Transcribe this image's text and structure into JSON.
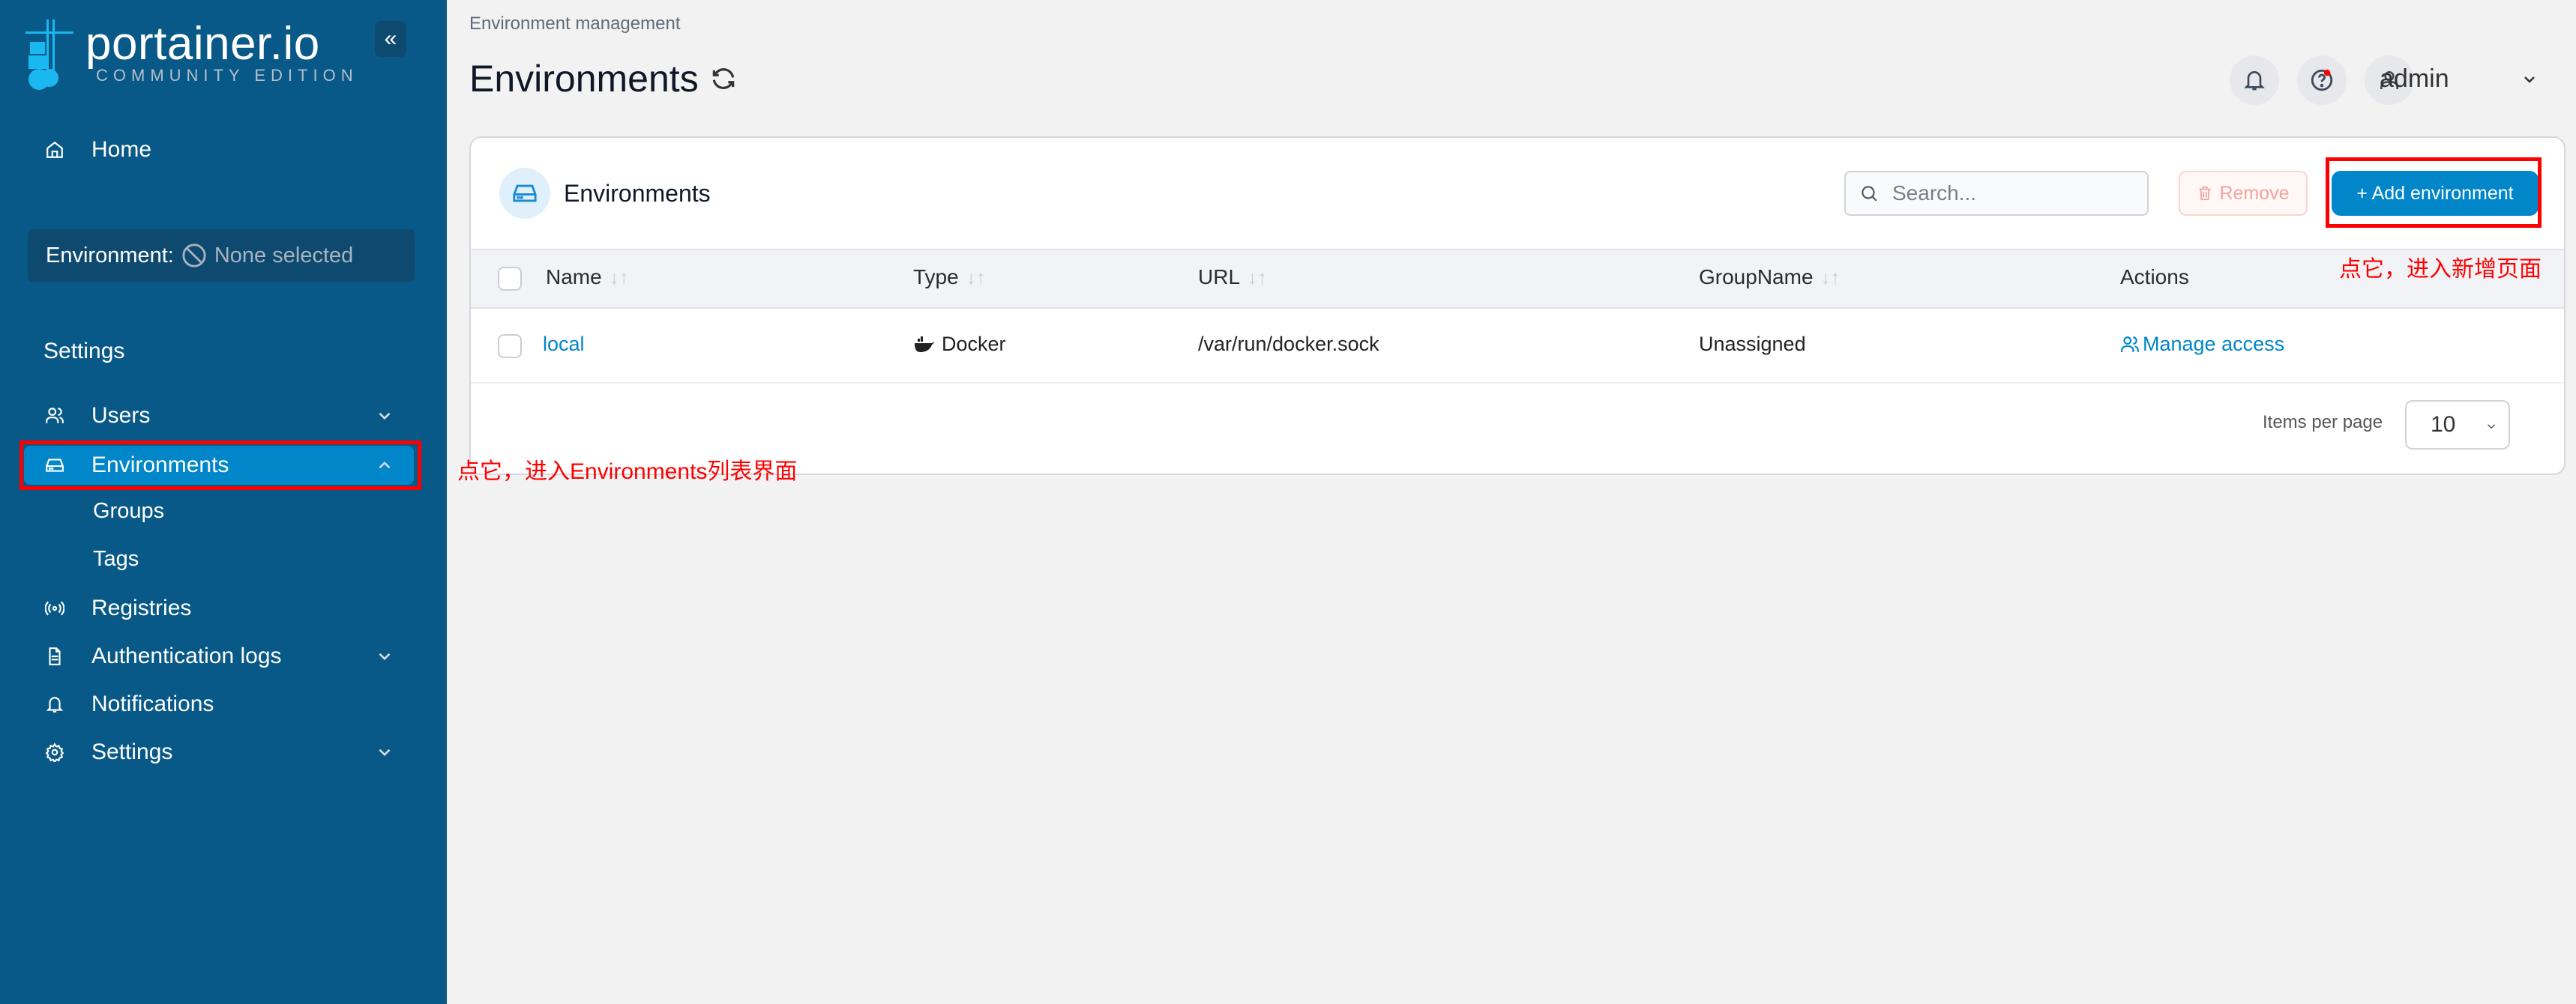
{
  "app": {
    "logo_main": "portainer.io",
    "logo_sub": "COMMUNITY EDITION",
    "brand_color": "#085987",
    "accent_color": "#0086c9"
  },
  "sidebar": {
    "collapse_label": "«",
    "home_label": "Home",
    "environment_label": "Environment:",
    "environment_value": "None selected",
    "section_title": "Settings",
    "items": [
      {
        "label": "Users",
        "icon": "users-icon",
        "has_chevron": true,
        "expanded": false
      },
      {
        "label": "Environments",
        "icon": "environments-icon",
        "has_chevron": true,
        "expanded": true,
        "active": true
      },
      {
        "label": "Groups",
        "sub": true
      },
      {
        "label": "Tags",
        "sub": true
      },
      {
        "label": "Registries",
        "icon": "registries-icon",
        "has_chevron": false
      },
      {
        "label": "Authentication logs",
        "icon": "file-icon",
        "has_chevron": true,
        "expanded": false
      },
      {
        "label": "Notifications",
        "icon": "bell-icon",
        "has_chevron": false
      },
      {
        "label": "Settings",
        "icon": "gear-icon",
        "has_chevron": true,
        "expanded": false
      }
    ]
  },
  "header": {
    "breadcrumb": "Environment management",
    "title": "Environments",
    "user": "admin"
  },
  "card": {
    "title": "Environments",
    "search_placeholder": "Search...",
    "remove_label": "Remove",
    "add_label": "+ Add environment",
    "columns": [
      "Name",
      "Type",
      "URL",
      "GroupName",
      "Actions"
    ],
    "rows": [
      {
        "name": "local",
        "type": "Docker",
        "url": "/var/run/docker.sock",
        "group": "Unassigned",
        "action": "Manage access"
      }
    ],
    "items_per_page_label": "Items per page",
    "items_per_page_value": "10"
  },
  "annotations": {
    "sidebar_note": "点它，进入Environments列表界面",
    "add_note": "点它，进入新增页面"
  }
}
